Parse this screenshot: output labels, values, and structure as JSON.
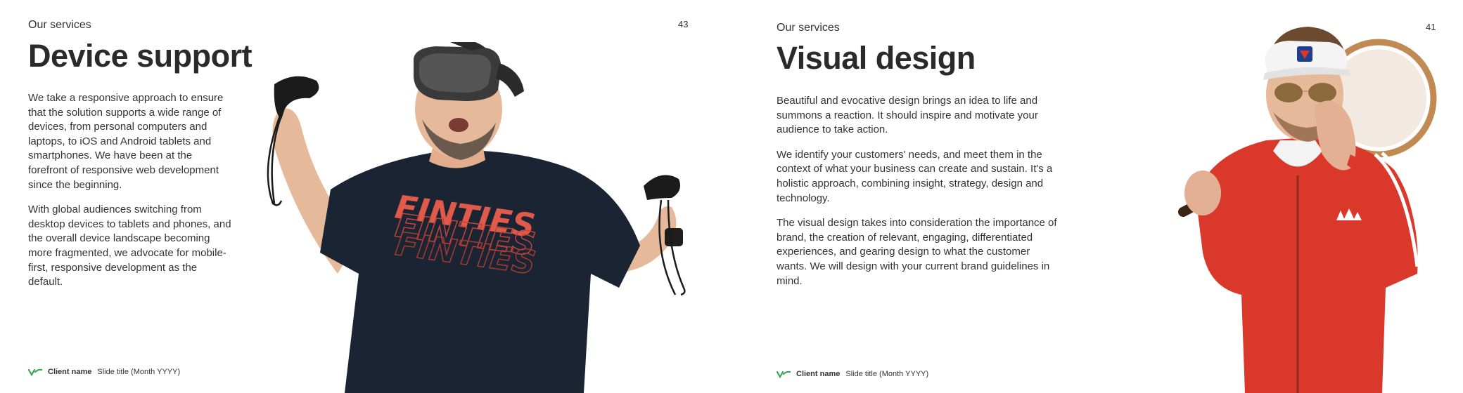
{
  "slides": [
    {
      "eyebrow": "Our services",
      "page_number": "43",
      "title": "Device support",
      "paragraphs": [
        "We take a responsive approach to ensure that the solution supports a wide range of devices, from personal computers and laptops, to iOS and Android tablets and smartphones. We have been at the forefront of responsive web development since the beginning.",
        "With global audiences switching from desktop devices to tablets and phones, and the overall device landscape becoming more fragmented, we advocate for mobile-first, responsive development as the default."
      ],
      "photo": {
        "icon": "vr-headset-person-icon",
        "shirt_text": "FINTIES"
      },
      "footer": {
        "client_name": "Client name",
        "slide_title": "Slide title (Month YYYY)"
      }
    },
    {
      "eyebrow": "Our services",
      "page_number": "41",
      "title": "Visual design",
      "paragraphs": [
        "Beautiful and evocative design brings an idea to life and summons a reaction. It should inspire and motivate your audience to take action.",
        "We identify your customers' needs, and meet them in the context of what your business can create and sustain. It's a holistic approach, combining insight, strategy, design and technology.",
        "The visual design takes into consideration the importance of brand, the creation of relevant, engaging, differentiated experiences, and gearing design to what the customer wants. We will design with your current brand guidelines in mind."
      ],
      "photo": {
        "icon": "tennis-player-person-icon"
      },
      "footer": {
        "client_name": "Client name",
        "slide_title": "Slide title (Month YYYY)"
      }
    }
  ],
  "colors": {
    "accent_green": "#3aa65a",
    "text_dark": "#2a2a2a",
    "shirt_navy": "#1b2433",
    "jacket_red": "#d9382a"
  }
}
